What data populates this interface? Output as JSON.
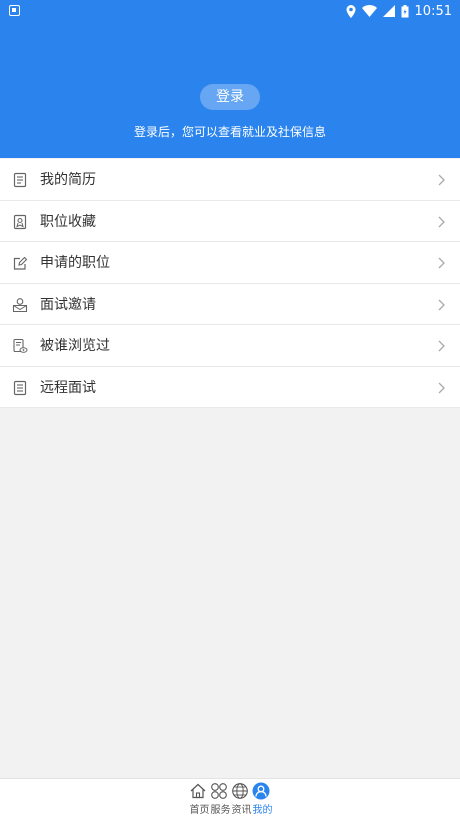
{
  "status_bar": {
    "time": "10:51"
  },
  "header": {
    "login_button": "登录",
    "login_tip": "登录后，您可以查看就业及社保信息",
    "background_color": "#2b84ee"
  },
  "menu": {
    "items": [
      {
        "label": "我的简历",
        "icon": "resume-icon"
      },
      {
        "label": "职位收藏",
        "icon": "bookmark-icon"
      },
      {
        "label": "申请的职位",
        "icon": "edit-icon"
      },
      {
        "label": "面试邀请",
        "icon": "invitation-icon"
      },
      {
        "label": "被谁浏览过",
        "icon": "viewed-icon"
      },
      {
        "label": "远程面试",
        "icon": "remote-interview-icon"
      }
    ]
  },
  "bottom_nav": {
    "tabs": [
      {
        "label": "首页",
        "icon": "home-icon"
      },
      {
        "label": "服务",
        "icon": "services-icon"
      },
      {
        "label": "资讯",
        "icon": "globe-icon"
      },
      {
        "label": "我的",
        "icon": "profile-icon",
        "active": true
      }
    ],
    "active_color": "#2b84ee"
  }
}
